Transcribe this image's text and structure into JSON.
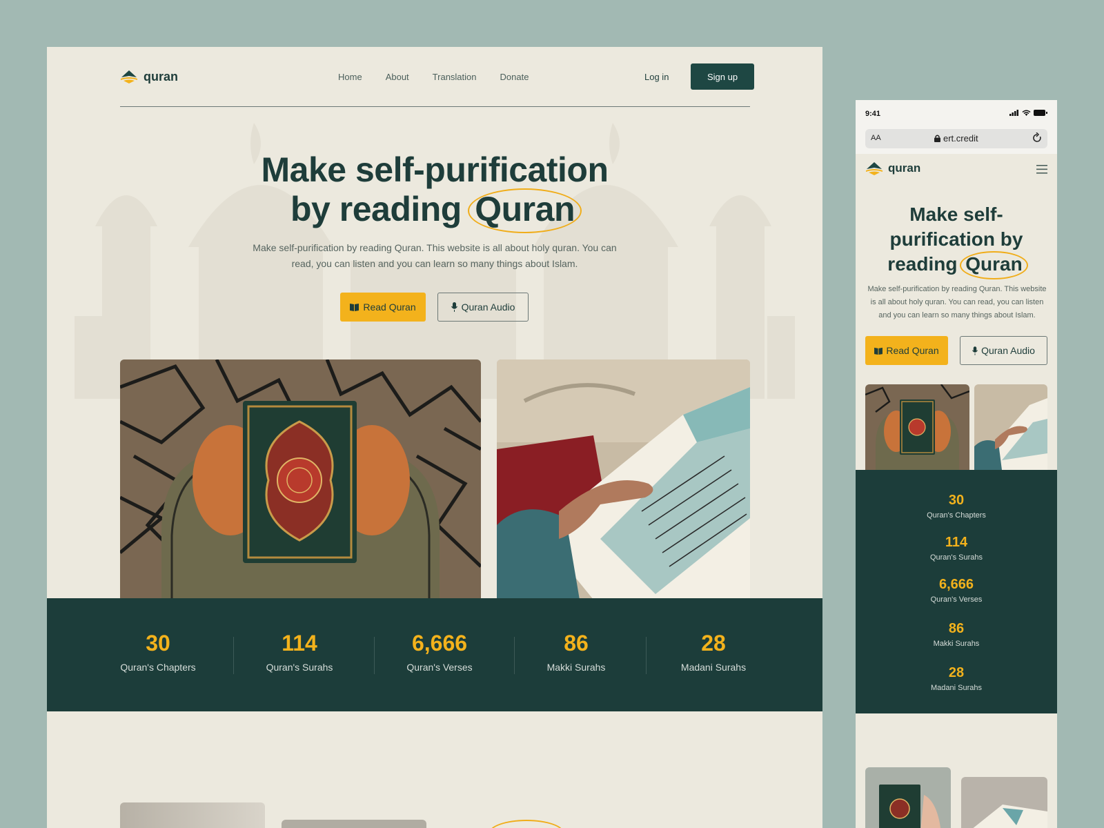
{
  "brand": {
    "name": "quran"
  },
  "nav": {
    "links": [
      "Home",
      "About",
      "Translation",
      "Donate"
    ],
    "login": "Log in",
    "signup": "Sign up"
  },
  "hero": {
    "title_line1": "Make self-purification",
    "title_line2": "by reading",
    "title_highlight": "Quran",
    "subtitle": "Make self-purification by reading Quran. This website is all about holy quran. You can read, you can listen and you can learn so many things about Islam.",
    "read_button": "Read Quran",
    "audio_button": "Quran Audio"
  },
  "stats": [
    {
      "value": "30",
      "label": "Quran's Chapters"
    },
    {
      "value": "114",
      "label": "Quran's Surahs"
    },
    {
      "value": "6,666",
      "label": "Quran's Verses"
    },
    {
      "value": "86",
      "label": "Makki Surahs"
    },
    {
      "value": "28",
      "label": "Madani Surahs"
    }
  ],
  "mobile": {
    "time": "9:41",
    "url_aa": "AA",
    "url": "ert.credit",
    "title_line1": "Make self-",
    "title_line2": "purification by",
    "title_line3": "reading",
    "title_highlight": "Quran",
    "subtitle": "Make self-purification by reading Quran. This website is all about holy quran. You can read, you can listen and you can learn so many things about Islam.",
    "read_button": "Read Quran",
    "audio_button": "Quran Audio"
  },
  "colors": {
    "primary": "#1e4743",
    "accent": "#f3b21c",
    "background": "#ece9de",
    "outer": "#a2b9b3"
  }
}
